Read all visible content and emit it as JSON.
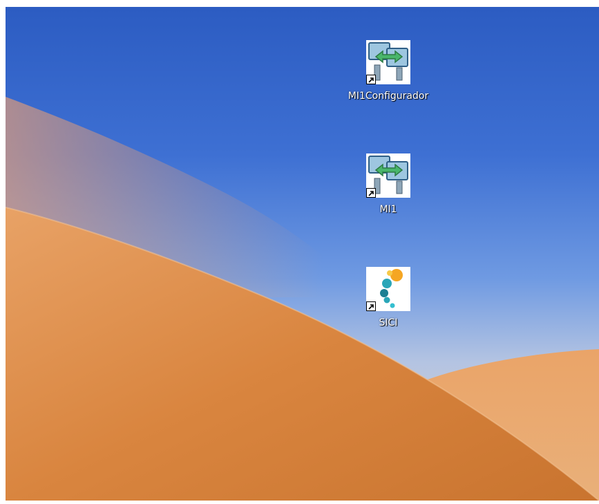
{
  "desktop": {
    "icons": [
      {
        "label": "MI1Configurador",
        "icon": "network-sync-icon"
      },
      {
        "label": "MI1",
        "icon": "network-sync-icon"
      },
      {
        "label": "SICI",
        "icon": "sici-dots-icon"
      }
    ],
    "shortcut_overlay_icon": "shortcut-arrow-icon"
  },
  "colors": {
    "sky_top": "#2f5fc4",
    "sky_mid": "#8fb2e6",
    "dune": "#d98a45",
    "dune_light": "#eab07a",
    "label_text": "#ffffff"
  }
}
